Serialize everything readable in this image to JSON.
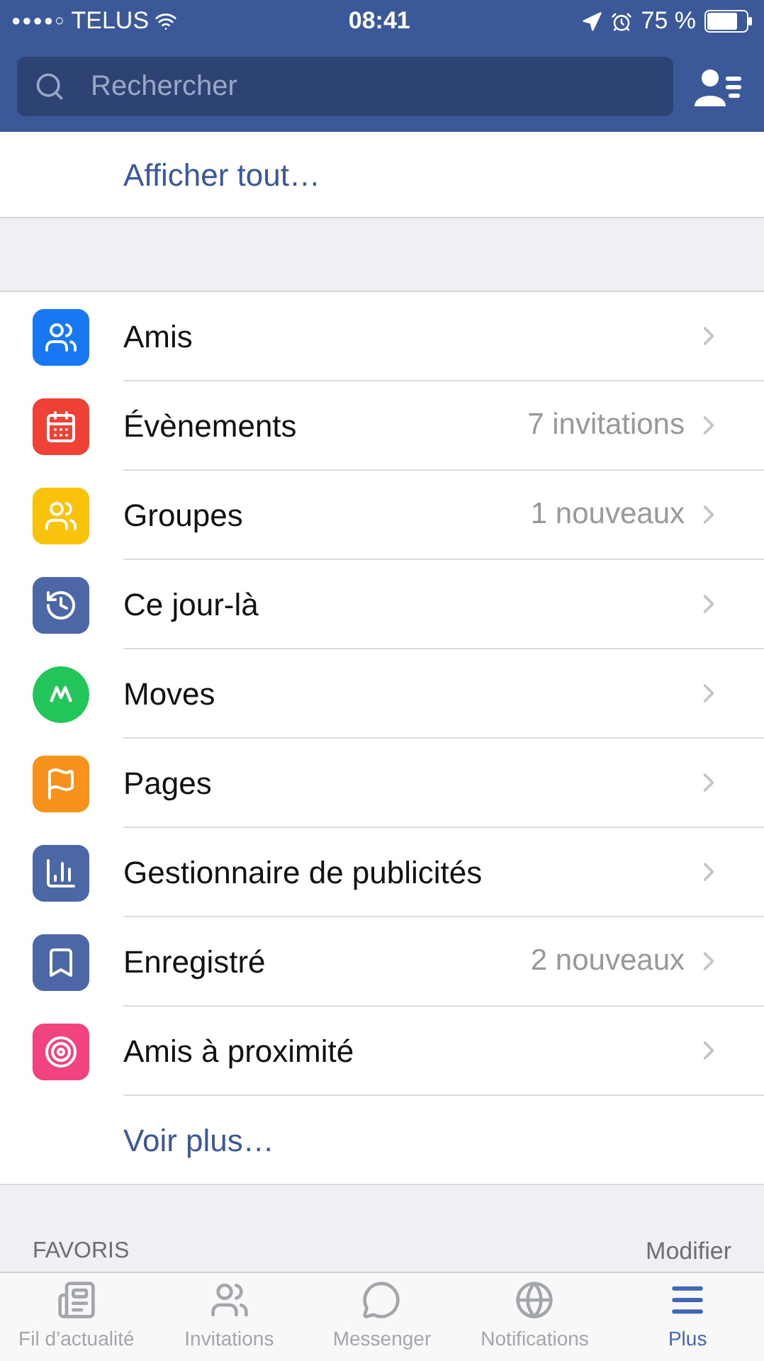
{
  "status_bar": {
    "signal_dots": "●●●●○",
    "carrier": "TELUS",
    "time": "08:41",
    "battery": "75 %"
  },
  "search": {
    "placeholder": "Rechercher"
  },
  "show_all": "Afficher tout…",
  "menu_items": [
    {
      "label": "Amis",
      "color": "#1877f2"
    },
    {
      "label": "Évènements",
      "detail": "7 invitations",
      "color": "#ef4135"
    },
    {
      "label": "Groupes",
      "detail": "1 nouveaux",
      "color": "#f9c20b"
    },
    {
      "label": "Ce jour-là",
      "color": "#4b67a5"
    },
    {
      "label": "Moves",
      "color": "#21c55a"
    },
    {
      "label": "Pages",
      "color": "#f7921d"
    },
    {
      "label": "Gestionnaire de publicités",
      "color": "#4b67a5"
    },
    {
      "label": "Enregistré",
      "detail": "2 nouveaux",
      "color": "#4b67a5"
    },
    {
      "label": "Amis à proximité",
      "color": "#f1437f"
    }
  ],
  "see_more": "Voir plus…",
  "favorites": {
    "title": "FAVORIS",
    "action": "Modifier"
  },
  "tabs": [
    {
      "label": "Fil d’actualité",
      "selected": false
    },
    {
      "label": "Invitations",
      "selected": false
    },
    {
      "label": "Messenger",
      "selected": false
    },
    {
      "label": "Notifications",
      "selected": false
    },
    {
      "label": "Plus",
      "selected": true
    }
  ]
}
